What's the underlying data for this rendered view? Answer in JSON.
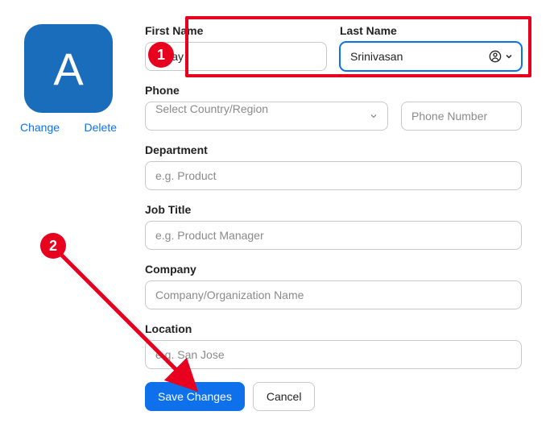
{
  "avatar": {
    "initial": "A",
    "change_label": "Change",
    "delete_label": "Delete"
  },
  "fields": {
    "first_name": {
      "label": "First Name",
      "value": "Ajaay"
    },
    "last_name": {
      "label": "Last Name",
      "value": "Srinivasan"
    },
    "phone": {
      "label": "Phone",
      "country_placeholder": "Select Country/Region",
      "number_placeholder": "Phone Number"
    },
    "department": {
      "label": "Department",
      "placeholder": "e.g. Product"
    },
    "job_title": {
      "label": "Job Title",
      "placeholder": "e.g. Product Manager"
    },
    "company": {
      "label": "Company",
      "placeholder": "Company/Organization Name"
    },
    "location": {
      "label": "Location",
      "placeholder": "e.g. San Jose"
    }
  },
  "buttons": {
    "save": "Save Changes",
    "cancel": "Cancel"
  },
  "annotations": {
    "step1": "1",
    "step2": "2"
  }
}
